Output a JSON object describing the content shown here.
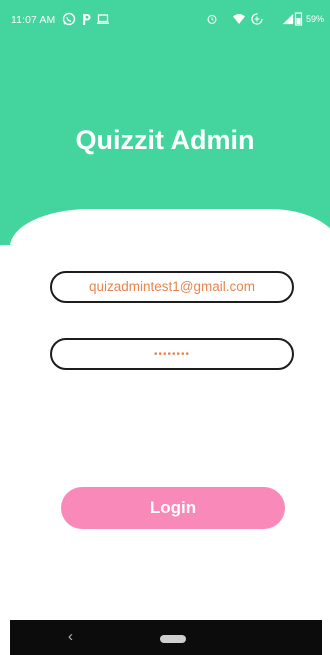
{
  "status_bar": {
    "time": "11:07 AM",
    "battery": "59%",
    "icons_left": [
      "whatsapp-icon",
      "p-app-icon",
      "laptop-icon"
    ],
    "icons_right": [
      "alarm-icon",
      "wifi-icon",
      "data-saver-icon",
      "signal-icon",
      "battery-icon"
    ]
  },
  "app": {
    "title": "Quizzit Admin"
  },
  "form": {
    "email_value": "quizadmintest1@gmail.com",
    "password_value": "••••••••"
  },
  "login_label": "Login",
  "nav": {
    "back_glyph": "‹"
  },
  "colors": {
    "header_green": "#44d49e",
    "login_pink": "#f889b9",
    "input_text_orange": "#e8854e"
  }
}
